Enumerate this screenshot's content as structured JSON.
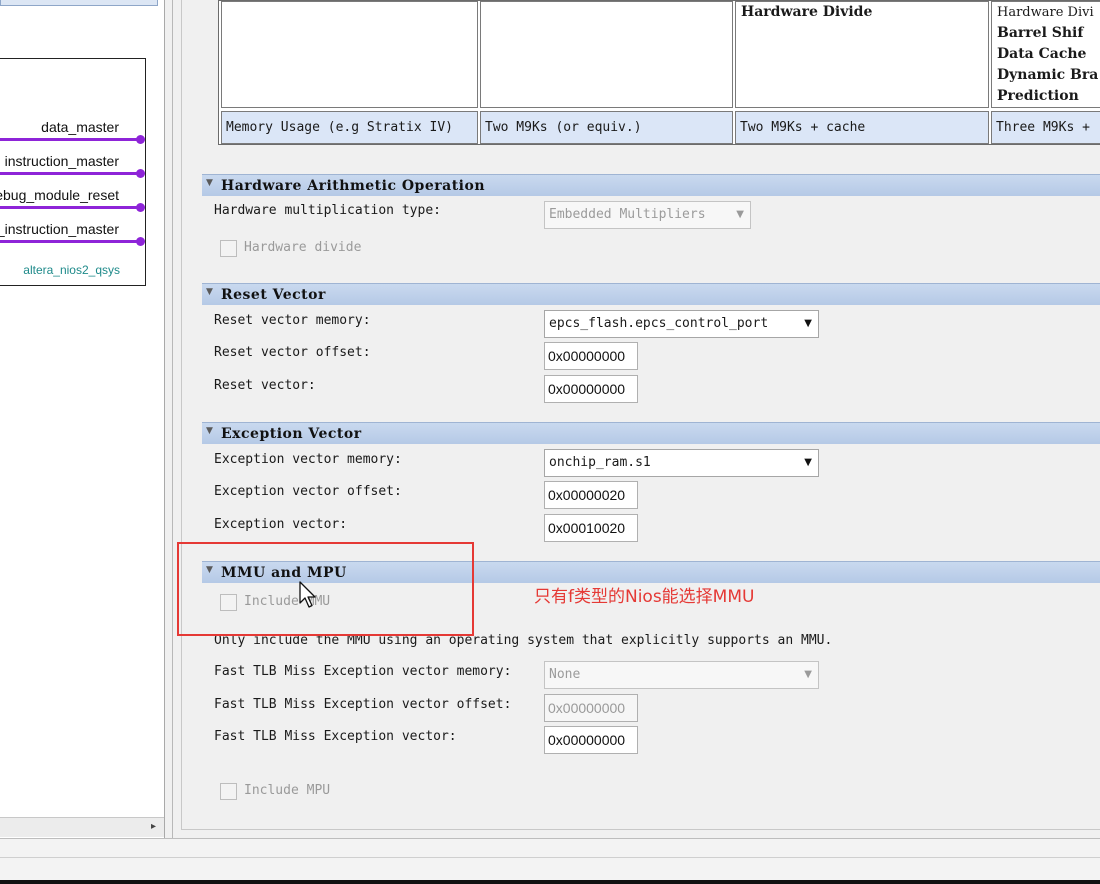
{
  "schematic": {
    "ports": [
      "data_master",
      "instruction_master",
      "debug_module_reset",
      "n_instruction_master"
    ],
    "component_name": "altera_nios2_qsys",
    "port_color": "#8e24d8"
  },
  "core_table": {
    "headers": [
      {
        "main": ""
      },
      {
        "main": ""
      },
      {
        "main": "Hardware Divide"
      },
      {
        "plain": "Hardware Divi",
        "lines": [
          "Barrel Shif",
          "Data Cache",
          "Dynamic Bra",
          "Prediction"
        ]
      }
    ],
    "memory_row": [
      "Memory Usage (e.g Stratix IV)",
      "Two M9Ks (or equiv.)",
      "Two M9Ks + cache",
      "Three M9Ks +"
    ]
  },
  "hw_arith": {
    "title": "Hardware Arithmetic Operation",
    "mult_label": "Hardware multiplication type:",
    "mult_value": "Embedded Multipliers",
    "divide_label": "Hardware divide"
  },
  "reset_vector": {
    "title": "Reset Vector",
    "memory_label": "Reset vector memory:",
    "memory_value": "epcs_flash.epcs_control_port",
    "offset_label": "Reset vector offset:",
    "offset_value": "0x00000000",
    "vector_label": "Reset vector:",
    "vector_value": "0x00000000"
  },
  "exception_vector": {
    "title": "Exception Vector",
    "memory_label": "Exception vector memory:",
    "memory_value": "onchip_ram.s1",
    "offset_label": "Exception vector offset:",
    "offset_value": "0x00000020",
    "vector_label": "Exception vector:",
    "vector_value": "0x00010020"
  },
  "mmu_mpu": {
    "title": "MMU and MPU",
    "include_mmu_label": "Include MMU",
    "note": "Only include the MMU using an operating system that explicitly supports an MMU.",
    "tlb_memory_label": "Fast TLB Miss Exception vector memory:",
    "tlb_memory_value": "None",
    "tlb_offset_label": "Fast TLB Miss Exception vector offset:",
    "tlb_offset_value": "0x00000000",
    "tlb_vector_label": "Fast TLB Miss Exception vector:",
    "tlb_vector_value": "0x00000000",
    "include_mpu_label": "Include MPU"
  },
  "annotation": {
    "text": "只有f类型的Nios能选择MMU",
    "color": "#e53935"
  }
}
